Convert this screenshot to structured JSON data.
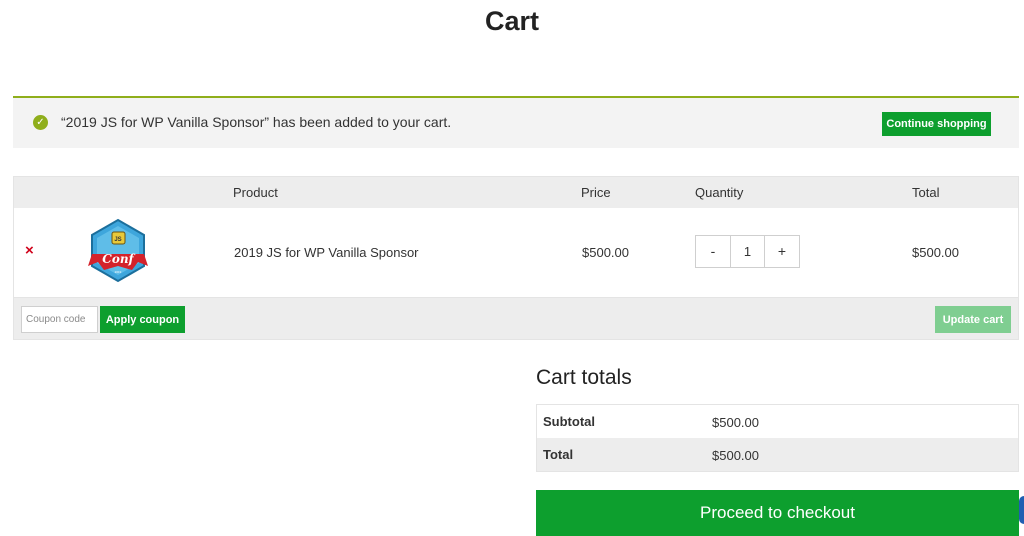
{
  "page": {
    "title": "Cart"
  },
  "notice": {
    "message": "“2019 JS for WP Vanilla Sponsor” has been added to your cart.",
    "continue_label": "Continue shopping",
    "check_icon": "✓"
  },
  "cart": {
    "headers": {
      "product": "Product",
      "price": "Price",
      "quantity": "Quantity",
      "total": "Total"
    },
    "item": {
      "remove_symbol": "×",
      "name": "2019 JS for WP Vanilla Sponsor",
      "price": "$500.00",
      "quantity": "1",
      "total": "$500.00",
      "thumbnail_logo_text": "Conf",
      "minus": "-",
      "plus": "+"
    },
    "coupon_placeholder": "Coupon code",
    "apply_label": "Apply coupon",
    "update_label": "Update cart"
  },
  "totals": {
    "title": "Cart totals",
    "subtotal_label": "Subtotal",
    "subtotal_value": "$500.00",
    "total_label": "Total",
    "total_value": "$500.00",
    "checkout_label": "Proceed to checkout"
  },
  "colors": {
    "accent_green": "#0d9f2e",
    "notice_border": "#8fae1b",
    "remove_red": "#d0021b",
    "update_disabled": "#7fce91"
  }
}
